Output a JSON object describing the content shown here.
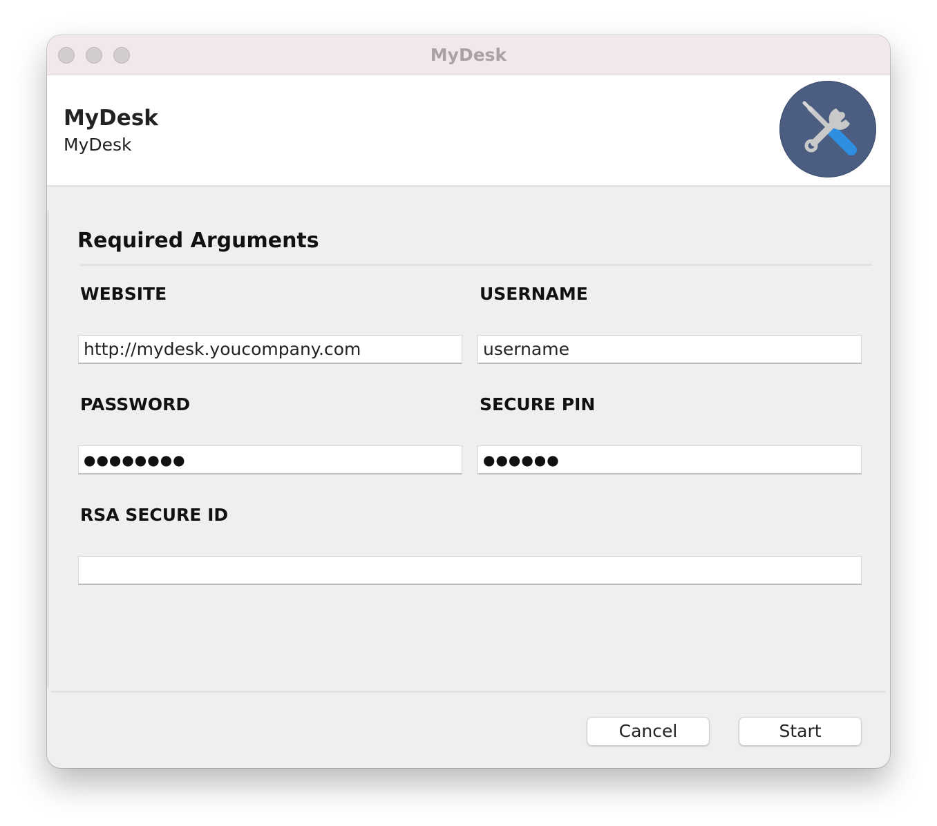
{
  "window": {
    "title": "MyDesk"
  },
  "header": {
    "app_name": "MyDesk",
    "app_subtitle": "MyDesk",
    "icon": "tools-icon",
    "icon_color": "#4b5e82"
  },
  "form": {
    "section_title": "Required Arguments",
    "fields": {
      "website": {
        "label": "WEBSITE",
        "value": "http://mydesk.youcompany.com"
      },
      "username": {
        "label": "USERNAME",
        "value": "username"
      },
      "password": {
        "label": "PASSWORD",
        "value": "●●●●●●●●"
      },
      "secure_pin": {
        "label": "SECURE PIN",
        "value": "●●●●●●"
      },
      "rsa_secure_id": {
        "label": "RSA SECURE ID",
        "value": ""
      }
    }
  },
  "footer": {
    "cancel_label": "Cancel",
    "start_label": "Start"
  }
}
